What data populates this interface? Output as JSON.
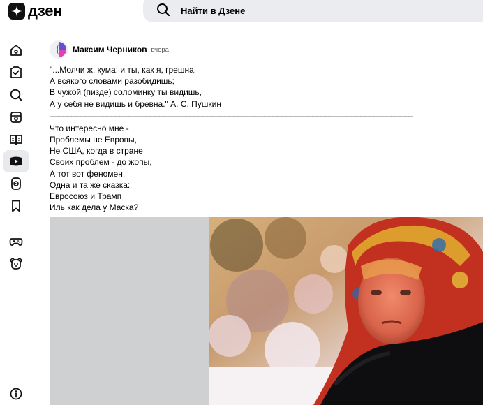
{
  "header": {
    "logo_text": "дзен",
    "search_label": "Найти в Дзене"
  },
  "sidebar": {
    "items": [
      {
        "icon": "home-icon"
      },
      {
        "icon": "subscriptions-icon"
      },
      {
        "icon": "search-icon"
      },
      {
        "icon": "articles-icon"
      },
      {
        "icon": "book-icon"
      },
      {
        "icon": "video-icon",
        "active": true
      },
      {
        "icon": "shorts-icon"
      },
      {
        "icon": "bookmark-icon"
      },
      {
        "icon": "gamepad-icon"
      },
      {
        "icon": "kids-icon"
      },
      {
        "icon": "info-icon"
      }
    ]
  },
  "post": {
    "author": "Максим Черников",
    "time": "вчера",
    "lines": [
      "\"...Молчи ж, кума: и ты, как я, грешна,",
      "А всякого словами разобидишь;",
      "В чужой (пизде) соломинку ты видишь,",
      "А у себя не видишь и бревна.\" А. С. Пушкин",
      "______________________________________________________________________________________",
      "Что интересно мне -",
      "Проблемы не Европы,",
      "Не США, когда в стране",
      "Своих проблем - до жопы,",
      "А тот вот феномен,",
      "Одна и та же сказка:",
      "Евросоюз и Трамп",
      "Иль как дела у Маска?"
    ]
  },
  "colors": {
    "search_bg": "#ebecef",
    "active_nav_bg": "#e8e9ec",
    "image_placeholder": "#cfd0d2"
  }
}
